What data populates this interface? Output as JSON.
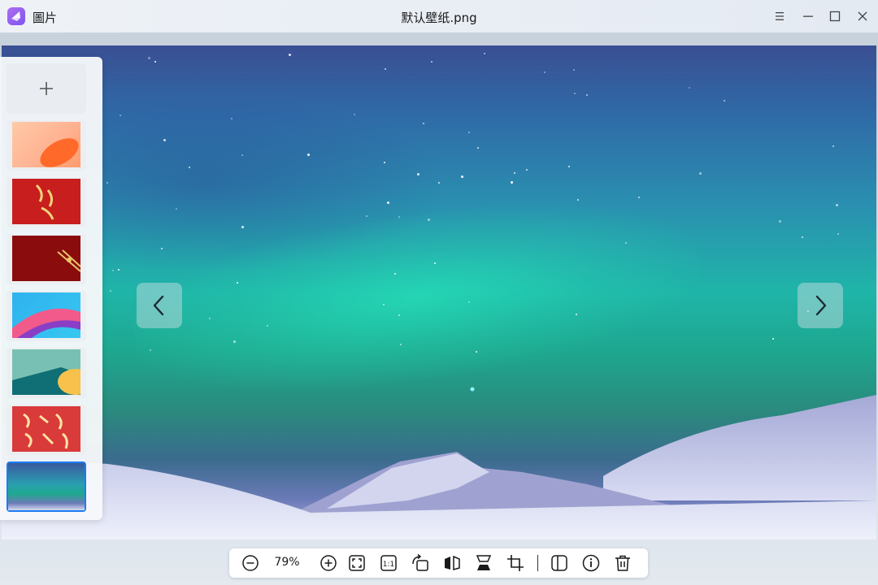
{
  "app": {
    "name": "圖片",
    "window_title": "默认壁纸.png"
  },
  "window_controls": {
    "menu_icon": "hamburger-menu-icon",
    "minimize_icon": "minimize-icon",
    "maximize_icon": "maximize-icon",
    "close_icon": "close-icon"
  },
  "viewer": {
    "prev_icon": "chevron-left-icon",
    "next_icon": "chevron-right-icon"
  },
  "sidebar": {
    "add_icon": "plus-icon",
    "thumbnails": [
      {
        "name": "orange-gradient"
      },
      {
        "name": "red-calligraphy"
      },
      {
        "name": "dark-red-gold"
      },
      {
        "name": "colorful-ribbon"
      },
      {
        "name": "teal-yellow"
      },
      {
        "name": "red-slogan"
      },
      {
        "name": "aurora",
        "active": true
      }
    ]
  },
  "toolbar": {
    "zoom_value": "79%",
    "ratio_label": "1:1"
  },
  "colors": {
    "accent": "#1c7cf4",
    "logo_start": "#b06cf0",
    "logo_end": "#7a56ef"
  }
}
